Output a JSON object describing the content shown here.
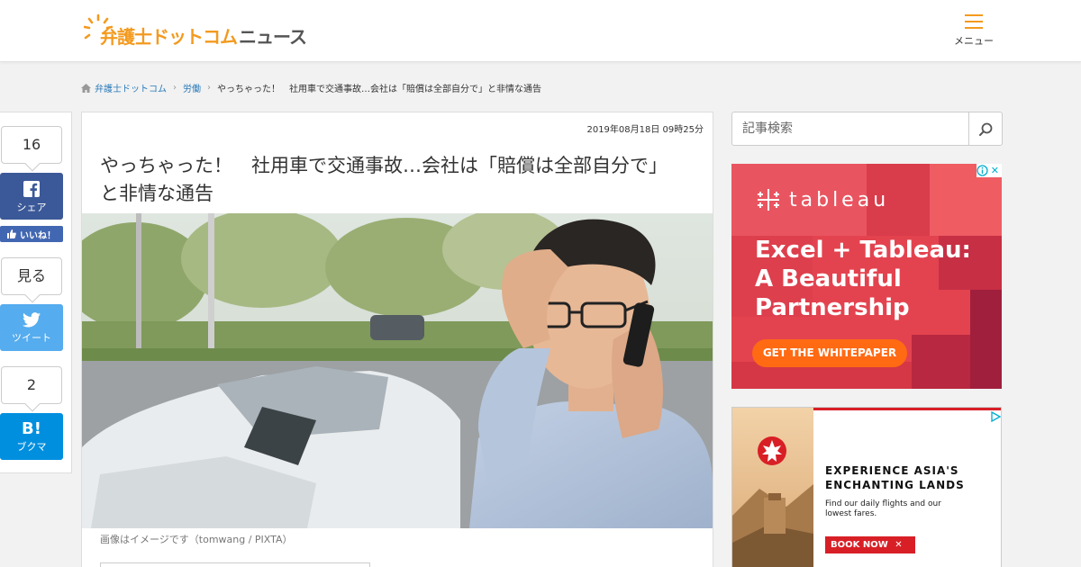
{
  "header": {
    "logo_part1": "弁護士ドットコム",
    "logo_part2": "ニュース",
    "menu_label": "メニュー"
  },
  "breadcrumb": {
    "items": [
      "弁護士ドットコム",
      "労働",
      "やっちゃった！　社用車で交通事故…会社は「賠償は全部自分で」と非情な通告"
    ]
  },
  "share": {
    "fb_count": "16",
    "fb_label": "シェア",
    "like_label": "いいね！",
    "tw_count": "見る",
    "tw_label": "ツイート",
    "hb_count": "2",
    "hb_icon": "B!",
    "hb_label": "ブクマ"
  },
  "article": {
    "date": "2019年08月18日 09時25分",
    "title": "やっちゃった！　社用車で交通事故…会社は「賠償は全部自分で」と非情な通告",
    "caption": "画像はイメージです（tomwang / PIXTA）"
  },
  "search": {
    "placeholder": "記事検索"
  },
  "ad1": {
    "brand": "tableau",
    "headline_lines": [
      "Excel + Tableau:",
      "A Beautiful",
      "Partnership"
    ],
    "cta": "GET THE WHITEPAPER"
  },
  "ad2": {
    "title_lines": [
      "EXPERIENCE ASIA'S",
      "ENCHANTING LANDS"
    ],
    "sub_lines": [
      "Find our daily flights and our",
      "lowest fares."
    ],
    "cta": "BOOK NOW"
  },
  "colors": {
    "brand_orange": "#f39a1e",
    "link_blue": "#2b7bb9",
    "facebook": "#3b5998",
    "twitter": "#55acee",
    "hatena": "#008fde",
    "tableau_red": "#e0434f",
    "tableau_cta": "#ff6a13",
    "aircanada_red": "#d81f26"
  },
  "icons": [
    "logo-sun-icon",
    "hamburger-icon",
    "home-icon",
    "facebook-icon",
    "thumbs-up-icon",
    "twitter-icon",
    "hatena-icon",
    "search-icon",
    "tableau-logo-icon",
    "adchoices-icon",
    "maple-leaf-icon"
  ]
}
